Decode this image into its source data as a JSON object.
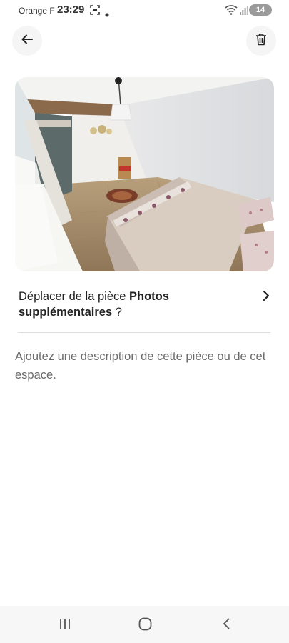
{
  "status_bar": {
    "carrier": "Orange F",
    "time": "23:29",
    "battery": "14"
  },
  "header": {
    "back_icon": "arrow-left-icon",
    "trash_icon": "trash-icon"
  },
  "photo": {
    "icon": "bedroom-photo"
  },
  "move": {
    "prefix": "Déplacer de la pièce ",
    "room": "Photos supplémentaires",
    "suffix": " ?"
  },
  "description": {
    "placeholder": "Ajoutez une description de cette pièce ou de cet espace."
  },
  "navigation_bar": {
    "icons": [
      "recent-apps-icon",
      "home-icon",
      "back-icon"
    ]
  }
}
